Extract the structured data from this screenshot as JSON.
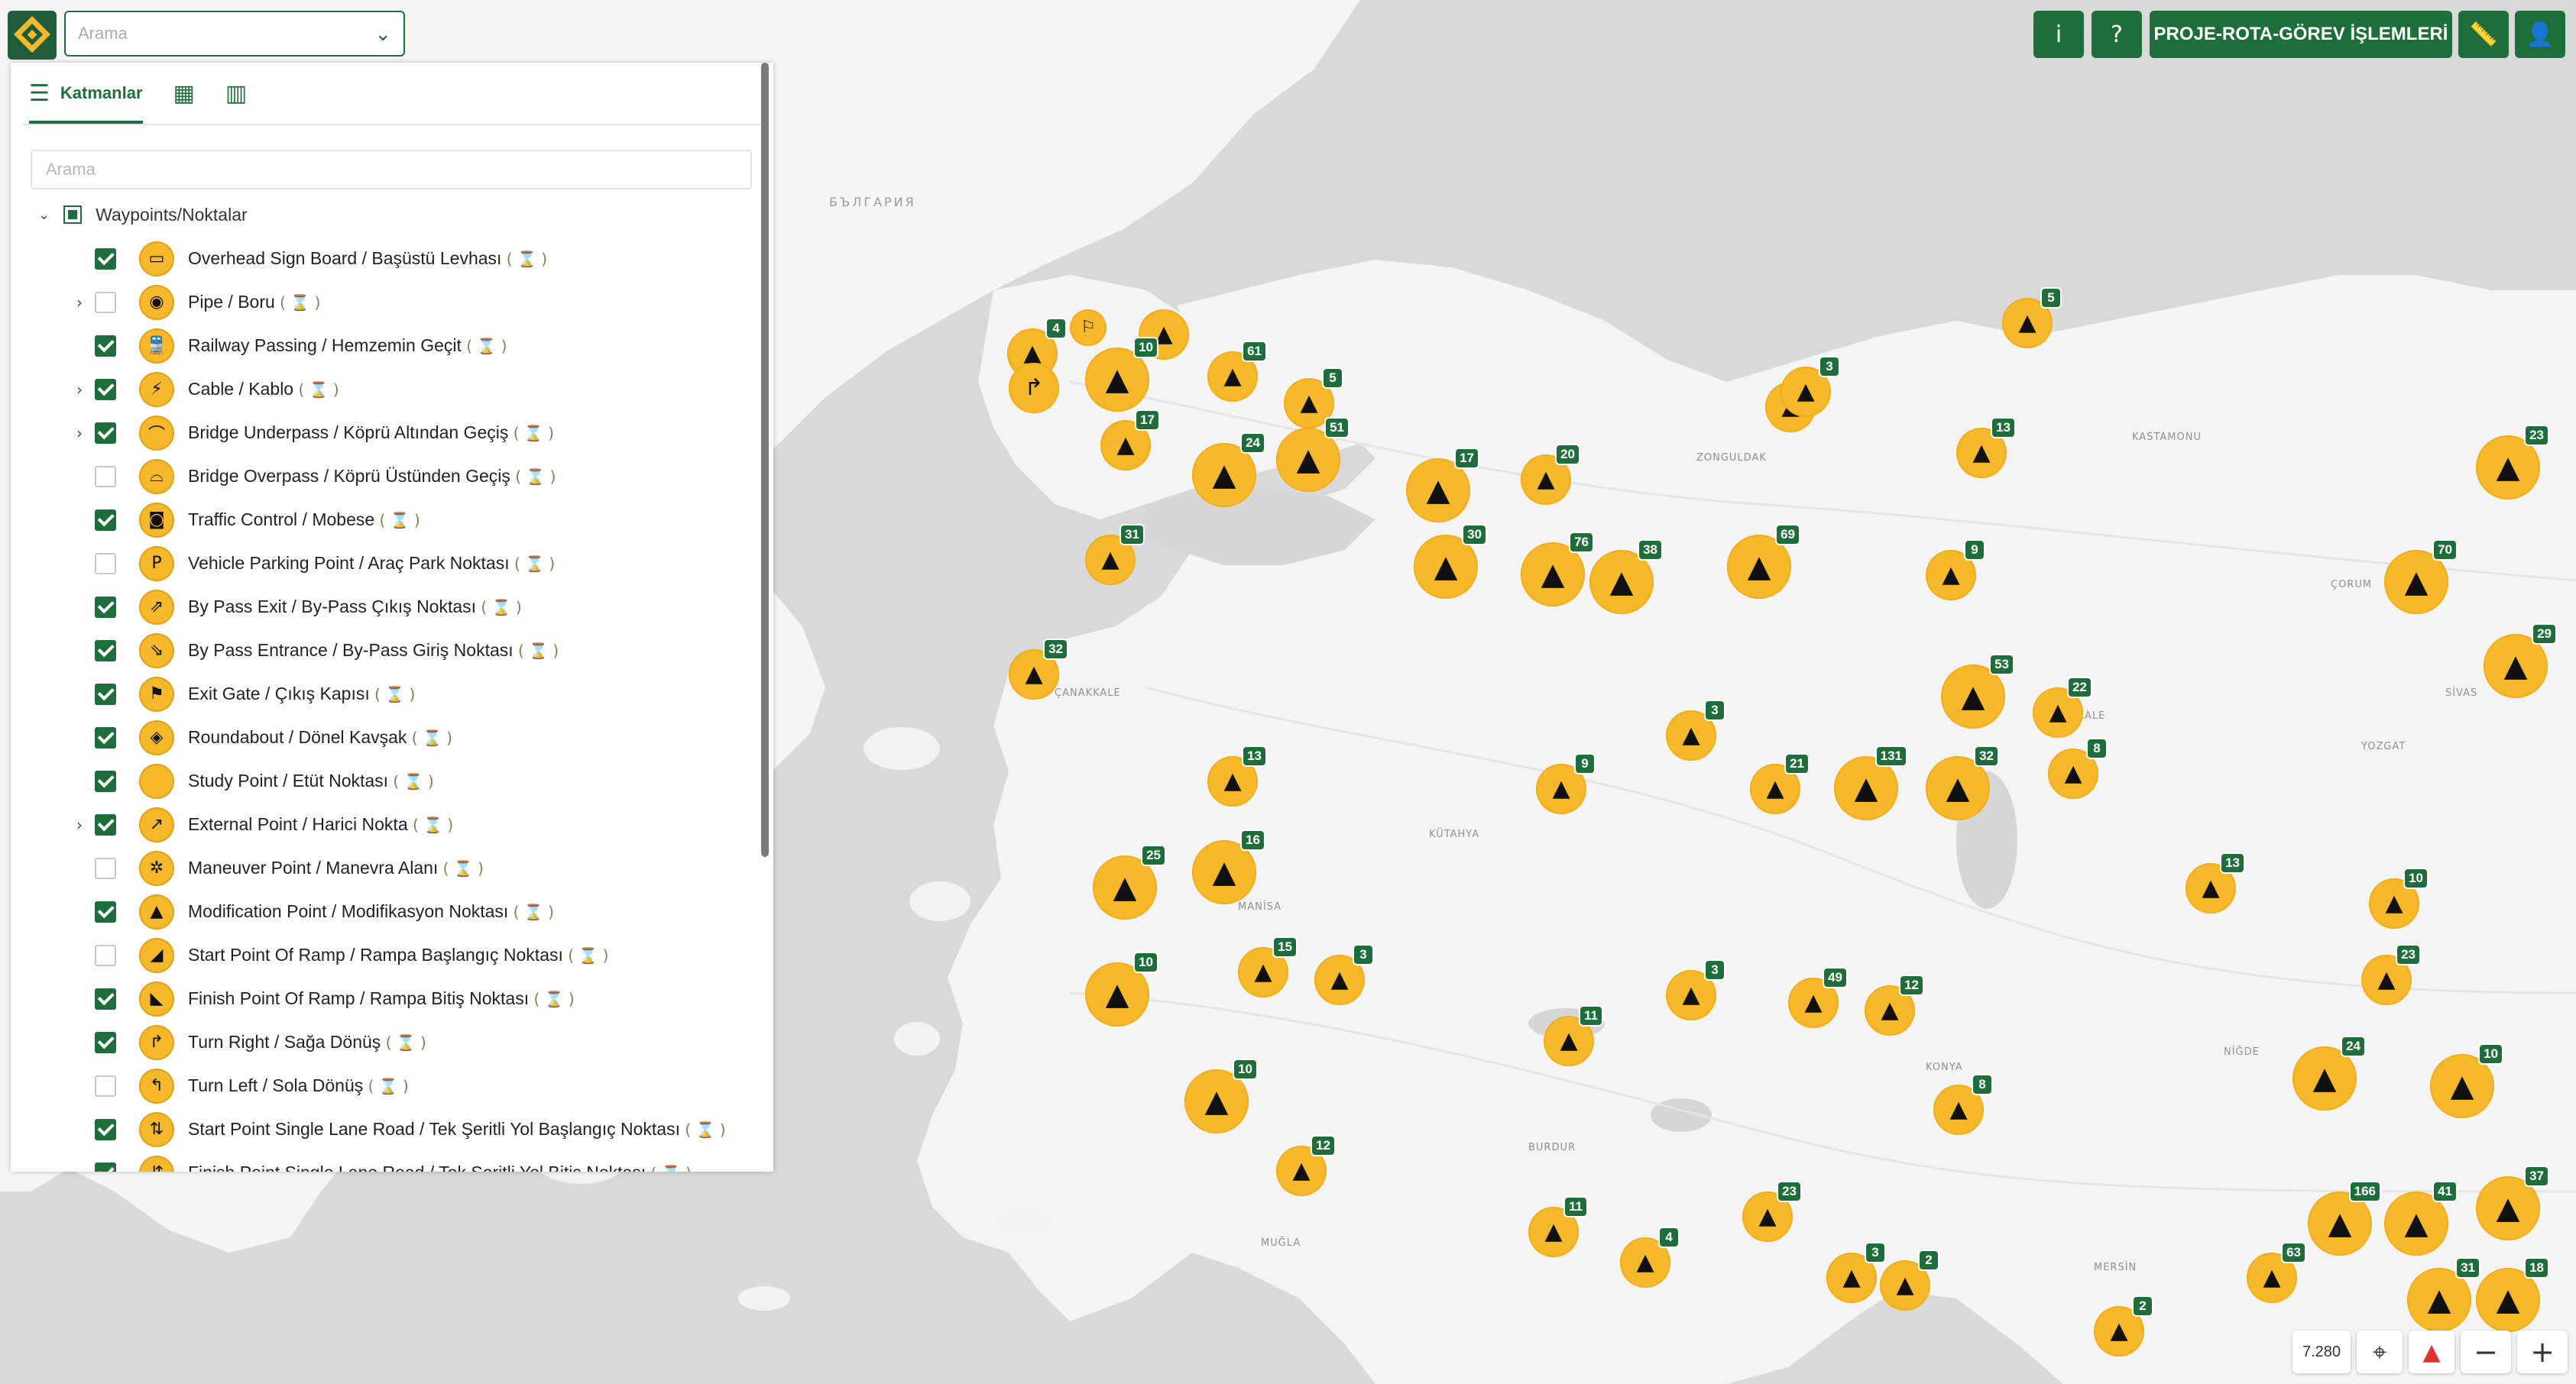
{
  "app": {
    "search_placeholder": "Arama",
    "logo_icon": "app-logo-icon"
  },
  "toolbar": {
    "info_label": "i",
    "help_label": "?",
    "main_button_label": "PROJE-ROTA-GÖREV İŞLEMLERİ",
    "ruler_icon": "ruler-icon",
    "user_icon": "user-icon"
  },
  "panel": {
    "tabs": [
      {
        "label": "Katmanlar",
        "icon": "layers-icon"
      },
      {
        "label": "",
        "icon": "grid-icon"
      },
      {
        "label": "",
        "icon": "map-icon"
      }
    ],
    "search_placeholder": "Arama",
    "root_label": "Waypoints/Noktalar",
    "items": [
      {
        "label": "Overhead Sign Board / Başüstü Levhası",
        "checked": true,
        "expandable": false,
        "icon": "sign-board-icon"
      },
      {
        "label": "Pipe / Boru",
        "checked": false,
        "expandable": true,
        "icon": "pipe-icon"
      },
      {
        "label": "Railway Passing / Hemzemin Geçit",
        "checked": true,
        "expandable": false,
        "icon": "train-icon"
      },
      {
        "label": "Cable / Kablo",
        "checked": true,
        "expandable": true,
        "icon": "cable-icon"
      },
      {
        "label": "Bridge Underpass / Köprü Altından Geçiş",
        "checked": true,
        "expandable": true,
        "icon": "bridge-underpass-icon"
      },
      {
        "label": "Bridge Overpass / Köprü Üstünden Geçiş",
        "checked": false,
        "expandable": false,
        "icon": "bridge-overpass-icon"
      },
      {
        "label": "Traffic Control / Mobese",
        "checked": true,
        "expandable": false,
        "icon": "camera-icon"
      },
      {
        "label": "Vehicle Parking Point / Araç Park Noktası",
        "checked": false,
        "expandable": false,
        "icon": "parking-icon"
      },
      {
        "label": "By Pass Exit / By-Pass Çıkış Noktası",
        "checked": true,
        "expandable": false,
        "icon": "bypass-exit-icon"
      },
      {
        "label": "By Pass Entrance / By-Pass Giriş Noktası",
        "checked": true,
        "expandable": false,
        "icon": "bypass-entrance-icon"
      },
      {
        "label": "Exit Gate / Çıkış Kapısı",
        "checked": true,
        "expandable": false,
        "icon": "flag-icon"
      },
      {
        "label": "Roundabout / Dönel Kavşak",
        "checked": true,
        "expandable": false,
        "icon": "roundabout-icon"
      },
      {
        "label": "Study Point / Etüt Noktası",
        "checked": true,
        "expandable": false,
        "icon": "study-point-icon"
      },
      {
        "label": "External Point / Harici Nokta",
        "checked": true,
        "expandable": true,
        "icon": "external-link-icon"
      },
      {
        "label": "Maneuver Point / Manevra Alanı",
        "checked": false,
        "expandable": false,
        "icon": "maneuver-icon"
      },
      {
        "label": "Modification Point / Modifikasyon Noktası",
        "checked": true,
        "expandable": false,
        "icon": "warning-icon"
      },
      {
        "label": "Start Point Of Ramp / Rampa Başlangıç Noktası",
        "checked": false,
        "expandable": false,
        "icon": "ramp-start-icon"
      },
      {
        "label": "Finish Point Of Ramp / Rampa Bitiş Noktası",
        "checked": true,
        "expandable": false,
        "icon": "ramp-finish-icon"
      },
      {
        "label": "Turn Right / Sağa Dönüş",
        "checked": true,
        "expandable": false,
        "icon": "turn-right-icon"
      },
      {
        "label": "Turn Left / Sola Dönüş",
        "checked": false,
        "expandable": false,
        "icon": "turn-left-icon"
      },
      {
        "label": "Start Point Single Lane Road / Tek Şeritli Yol Başlangıç Noktası",
        "checked": true,
        "expandable": false,
        "icon": "single-lane-start-icon"
      },
      {
        "label": "Finish Point Single Lane Road / Tek Şeritli Yol Bitiş Noktası",
        "checked": true,
        "expandable": false,
        "icon": "single-lane-finish-icon"
      }
    ]
  },
  "map": {
    "places": [
      "БЪЛГАРИЯ",
      "ZONGULDAK",
      "KASTAMONU",
      "ÇORUM",
      "YOZGAT",
      "KÜTAHYA",
      "MANİSA",
      "NİĞDE",
      "MERSİN",
      "MUĞLA",
      "BURDUR",
      "KONYA",
      "ÇANAKKALE",
      "KIRIKKALE",
      "SİVAS"
    ],
    "markers": [
      {
        "glyph": "▲",
        "badge": "4"
      },
      {
        "glyph": "⚐",
        "badge": ""
      },
      {
        "glyph": "▲",
        "badge": ""
      },
      {
        "glyph": "▲",
        "badge": "10"
      },
      {
        "glyph": "▲",
        "badge": "61"
      },
      {
        "glyph": "▲",
        "badge": "5"
      },
      {
        "glyph": "↱",
        "badge": ""
      },
      {
        "glyph": "▲",
        "badge": "17"
      },
      {
        "glyph": "▲",
        "badge": "24"
      },
      {
        "glyph": "▲",
        "badge": "51"
      },
      {
        "glyph": "▲",
        "badge": "17"
      },
      {
        "glyph": "▲",
        "badge": "20"
      },
      {
        "glyph": "▲",
        "badge": "3"
      },
      {
        "glyph": "▲",
        "badge": "3"
      },
      {
        "glyph": "▲",
        "badge": "5"
      },
      {
        "glyph": "▲",
        "badge": "13"
      },
      {
        "glyph": "▲",
        "badge": "23"
      },
      {
        "glyph": "▲",
        "badge": "31"
      },
      {
        "glyph": "▲",
        "badge": "30"
      },
      {
        "glyph": "▲",
        "badge": "76"
      },
      {
        "glyph": "▲",
        "badge": "38"
      },
      {
        "glyph": "▲",
        "badge": "69"
      },
      {
        "glyph": "▲",
        "badge": "9"
      },
      {
        "glyph": "▲",
        "badge": "70"
      },
      {
        "glyph": "▲",
        "badge": "29"
      },
      {
        "glyph": "▲",
        "badge": "32"
      },
      {
        "glyph": "▲",
        "badge": "53"
      },
      {
        "glyph": "▲",
        "badge": "22"
      },
      {
        "glyph": "▲",
        "badge": "3"
      },
      {
        "glyph": "▲",
        "badge": "32"
      },
      {
        "glyph": "▲",
        "badge": "13"
      },
      {
        "glyph": "▲",
        "badge": "21"
      },
      {
        "glyph": "▲",
        "badge": "131"
      },
      {
        "glyph": "▲",
        "badge": "8"
      },
      {
        "glyph": "▲",
        "badge": "13"
      },
      {
        "glyph": "▲",
        "badge": "10"
      },
      {
        "glyph": "▲",
        "badge": "16"
      },
      {
        "glyph": "▲",
        "badge": "25"
      },
      {
        "glyph": "▲",
        "badge": "15"
      },
      {
        "glyph": "▲",
        "badge": "3"
      },
      {
        "glyph": "▲",
        "badge": "10"
      },
      {
        "glyph": "▲",
        "badge": "3"
      },
      {
        "glyph": "▲",
        "badge": "12"
      },
      {
        "glyph": "▲",
        "badge": "49"
      },
      {
        "glyph": "▲",
        "badge": "11"
      },
      {
        "glyph": "▲",
        "badge": "24"
      },
      {
        "glyph": "▲",
        "badge": "23"
      },
      {
        "glyph": "▲",
        "badge": "10"
      },
      {
        "glyph": "▲",
        "badge": "12"
      },
      {
        "glyph": "▲",
        "badge": "8"
      },
      {
        "glyph": "▲",
        "badge": "23"
      },
      {
        "glyph": "▲",
        "badge": "166"
      },
      {
        "glyph": "▲",
        "badge": "41"
      },
      {
        "glyph": "▲",
        "badge": "37"
      },
      {
        "glyph": "▲",
        "badge": "63"
      },
      {
        "glyph": "▲",
        "badge": "31"
      },
      {
        "glyph": "▲",
        "badge": "18"
      },
      {
        "glyph": "▲",
        "badge": "2"
      },
      {
        "glyph": "▲",
        "badge": "11"
      },
      {
        "glyph": "▲",
        "badge": "4"
      },
      {
        "glyph": "▲",
        "badge": "3"
      },
      {
        "glyph": "▲",
        "badge": "2"
      },
      {
        "glyph": "▲",
        "badge": "10"
      },
      {
        "glyph": "▲",
        "badge": "9"
      }
    ]
  },
  "controls": {
    "zoom_level": "7.280",
    "locate_icon": "crosshair-icon",
    "compass_icon": "compass-icon",
    "zoom_out": "−",
    "zoom_in": "+"
  },
  "colors": {
    "brand_green": "#1e6e3b",
    "marker_yellow": "#f6b92c",
    "sea": "#d8d8d8",
    "land": "#f4f4f4"
  }
}
